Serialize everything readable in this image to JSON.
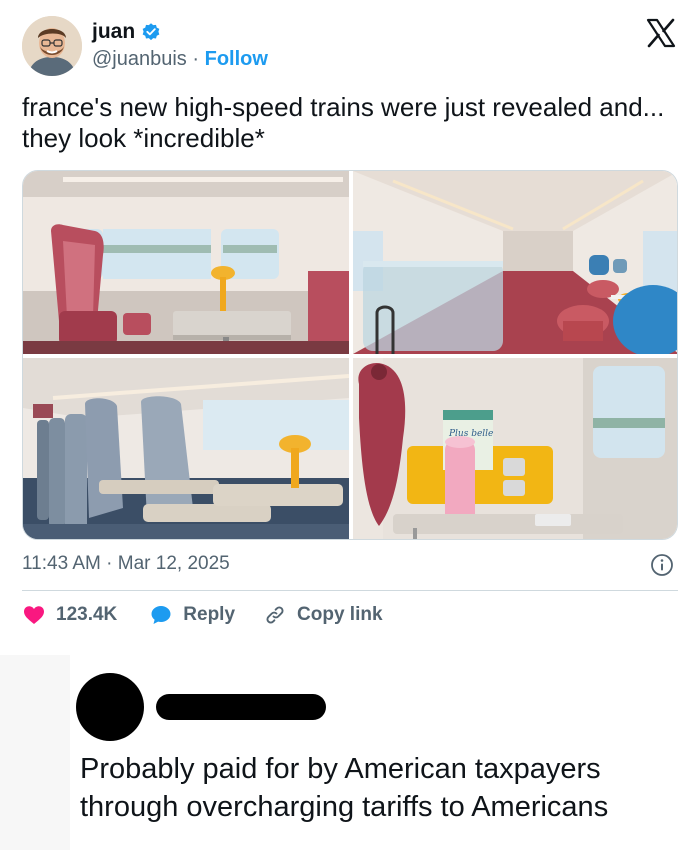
{
  "tweet": {
    "author": {
      "display_name": "juan",
      "handle": "@juanbuis",
      "separator": "·",
      "follow_label": "Follow",
      "verified_icon": "verified-badge-icon",
      "avatar": "avatar-photo"
    },
    "platform_logo": "x-logo-icon",
    "text": "france's new high-speed trains were just revealed and... they look *incredible*",
    "media": [
      {
        "name": "train-interior-photo-1",
        "book_text": ""
      },
      {
        "name": "train-interior-photo-2",
        "book_text": ""
      },
      {
        "name": "train-interior-photo-3",
        "book_text": ""
      },
      {
        "name": "train-interior-photo-4",
        "book_text": "Plus belle"
      }
    ],
    "timestamp": "11:43 AM · Mar 12, 2025",
    "info_icon": "info-icon",
    "actions": {
      "like_count": "123.4K",
      "reply_label": "Reply",
      "copy_link_label": "Copy link"
    },
    "colors": {
      "accent": "#1d9bf0",
      "like": "#f91880",
      "text": "#0f1419",
      "muted": "#536471"
    }
  },
  "comment": {
    "avatar": "redacted-avatar",
    "name": "redacted-name-bar",
    "text": "Probably paid for by American taxpayers through overcharging tariffs to Americans"
  }
}
